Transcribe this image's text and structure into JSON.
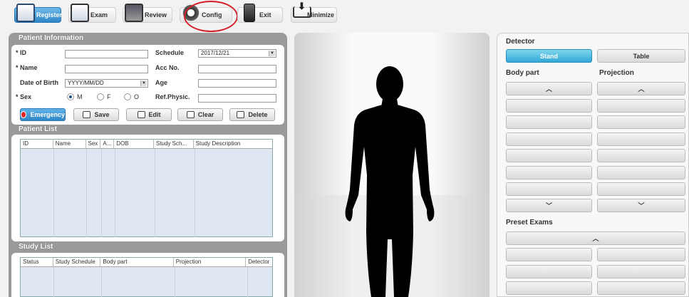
{
  "toolbar": {
    "register": "Register",
    "exam": "Exam",
    "review": "Review",
    "config": "Config",
    "exit": "Exit",
    "minimize": "Minimize"
  },
  "patient_info": {
    "title": "Patient Information",
    "id_label": "* ID",
    "name_label": "* Name",
    "dob_label": "Date of Birth",
    "dob_value": "YYYY/MM/DD",
    "sex_label": "* Sex",
    "sex_m": "M",
    "sex_f": "F",
    "sex_o": "O",
    "schedule_label": "Schedule",
    "schedule_value": "2017/12/21",
    "acc_label": "Acc No.",
    "age_label": "Age",
    "ref_label": "Ref.Physic.",
    "btn_emergency": "Emergency",
    "btn_save": "Save",
    "btn_edit": "Edit",
    "btn_clear": "Clear",
    "btn_delete": "Delete"
  },
  "patient_list": {
    "title": "Patient List",
    "columns": [
      "ID",
      "Name",
      "Sex",
      "A...",
      "DOB",
      "Study Sch...",
      "Study Description"
    ]
  },
  "study_list": {
    "title": "Study List",
    "columns": [
      "Status",
      "Study Schedule",
      "Body part",
      "Projection",
      "Detector"
    ]
  },
  "detector": {
    "title": "Detector",
    "stand": "Stand",
    "table": "Table"
  },
  "body_part": {
    "title": "Body part",
    "up": "^",
    "down": "v"
  },
  "projection": {
    "title": "Projection",
    "up": "^",
    "down": "v"
  },
  "preset": {
    "title": "Preset Exams",
    "up": "^"
  }
}
